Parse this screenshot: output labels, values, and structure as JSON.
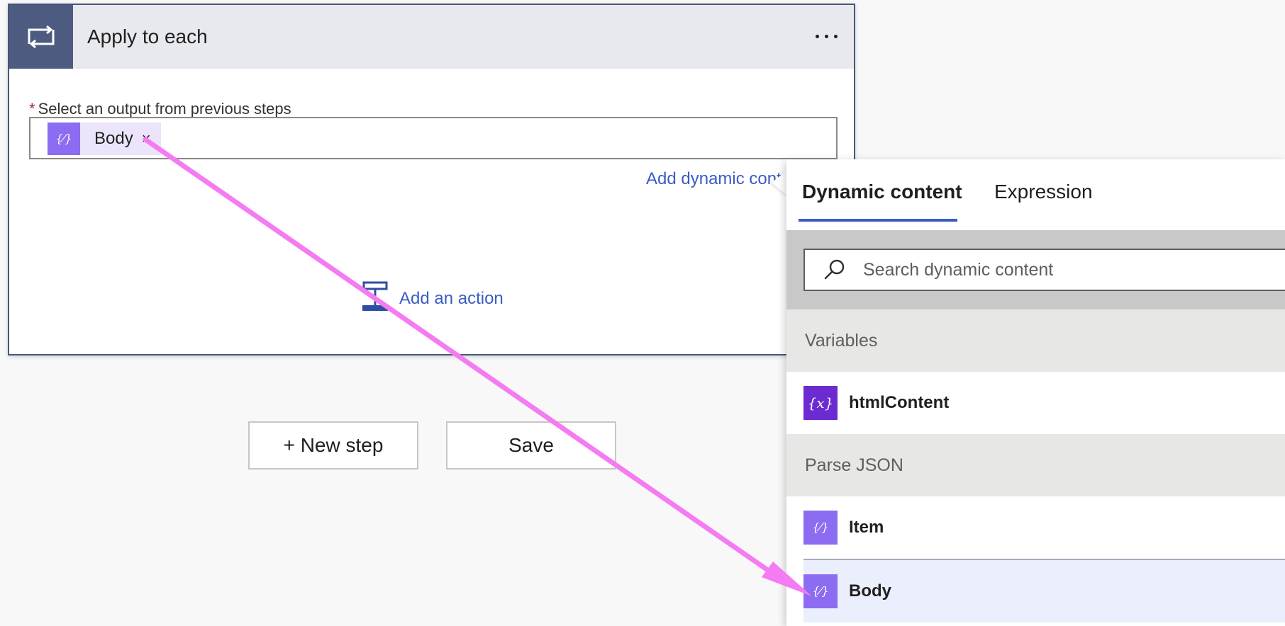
{
  "card": {
    "title": "Apply to each",
    "field_required_mark": "*",
    "field_label": "Select an output from previous steps",
    "token_label": "Body",
    "token_remove": "×",
    "add_dynamic_label": "Add dynamic content",
    "add_action_label": "Add an action"
  },
  "buttons": {
    "new_step": "+ New step",
    "save": "Save"
  },
  "panel": {
    "tabs": [
      {
        "label": "Dynamic content",
        "active": true
      },
      {
        "label": "Expression",
        "active": false
      }
    ],
    "search": {
      "placeholder": "Search dynamic content"
    },
    "sections": [
      {
        "title": "Variables",
        "items": [
          {
            "label": "htmlContent",
            "icon": "variable-icon"
          }
        ]
      },
      {
        "title": "Parse JSON",
        "items": [
          {
            "label": "Item",
            "icon": "json-icon"
          },
          {
            "label": "Body",
            "icon": "json-icon",
            "selected": true
          }
        ]
      }
    ]
  },
  "colors": {
    "card_header_icon_bg": "#4e5b80",
    "accent_blue": "#3b5cc4",
    "token_icon_purple": "#8c6cf0",
    "variable_icon_purple": "#6b2bd0",
    "annotation_arrow": "#f57bf2"
  }
}
